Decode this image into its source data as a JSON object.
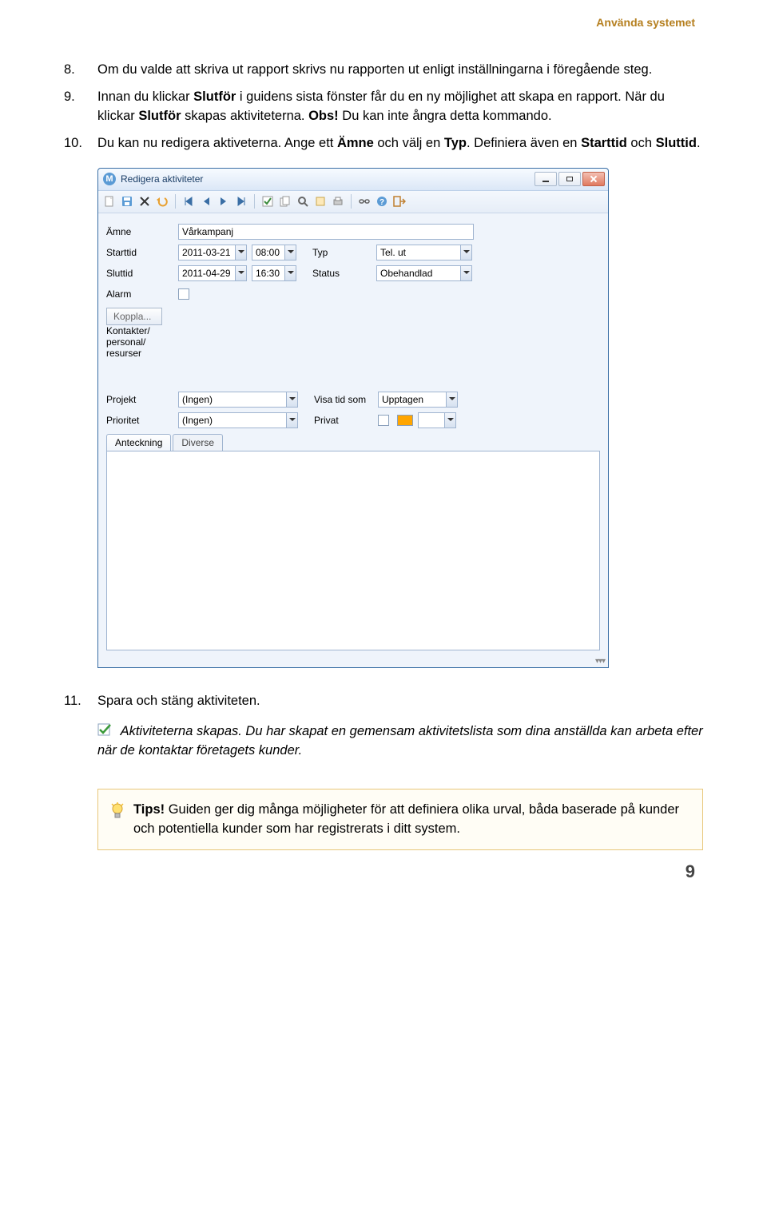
{
  "header": {
    "section": "Använda systemet"
  },
  "steps": {
    "s8": {
      "num": "8.",
      "text": "Om du valde att skriva ut rapport skrivs nu rapporten ut enligt inställningarna i föregående steg."
    },
    "s9": {
      "num": "9.",
      "pre": "Innan du klickar ",
      "b1": "Slutför",
      "mid1": " i guidens sista fönster får du en ny möjlighet att skapa en rapport. När du klickar ",
      "b2": "Slutför",
      "mid2": " skapas aktiviteterna. ",
      "b3": "Obs!",
      "post": " Du kan inte ångra detta kommando."
    },
    "s10": {
      "num": "10.",
      "pre": "Du kan nu redigera aktiveterna. Ange ett ",
      "b1": "Ämne",
      "mid1": " och välj en ",
      "b2": "Typ",
      "mid2": ". Definiera även en ",
      "b3": "Starttid",
      "mid3": " och ",
      "b4": "Sluttid",
      "post": "."
    },
    "s11": {
      "num": "11.",
      "text": "Spara och stäng aktiviteten."
    }
  },
  "window": {
    "title": "Redigera aktiviteter",
    "labels": {
      "amne": "Ämne",
      "starttid": "Starttid",
      "sluttid": "Sluttid",
      "alarm": "Alarm",
      "typ": "Typ",
      "status": "Status",
      "koppla": "Koppla...",
      "kontakter": "Kontakter/\npersonal/\nresurser",
      "projekt": "Projekt",
      "prioritet": "Prioritet",
      "visatid": "Visa tid som",
      "privat": "Privat"
    },
    "values": {
      "amne": "Vårkampanj",
      "start_date": "2011-03-21",
      "start_time": "08:00",
      "end_date": "2011-04-29",
      "end_time": "16:30",
      "typ": "Tel. ut",
      "status": "Obehandlad",
      "projekt": "(Ingen)",
      "prioritet": "(Ingen)",
      "visatid": "Upptagen"
    },
    "tabs": {
      "anteckning": "Anteckning",
      "diverse": "Diverse"
    }
  },
  "callout": {
    "italic": "Aktiviteterna skapas. Du har skapat en gemensam aktivitetslista som dina anställda kan arbeta efter när de kontaktar företagets kunder."
  },
  "tips": {
    "label": "Tips!",
    "text": " Guiden ger dig många möjligheter för att definiera olika urval, båda baserade på kunder och potentiella kunder som har registrerats i ditt system."
  },
  "page_number": "9"
}
